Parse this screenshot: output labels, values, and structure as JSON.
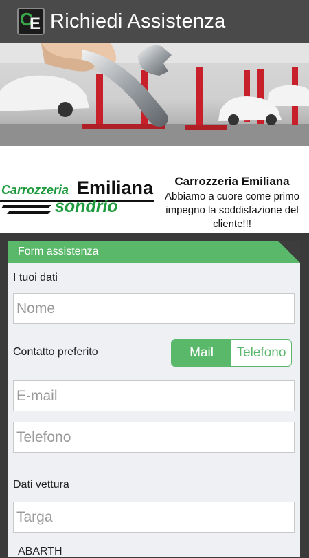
{
  "actionbar": {
    "title": "Richiedi Assistenza",
    "logo_letters": [
      "C",
      "E"
    ]
  },
  "hero": {
    "image": "car-repair-wrench-photo"
  },
  "brand": {
    "logo_line1": "Carrozzeria",
    "logo_line1b": "Emiliana",
    "logo_line2": "sondrio",
    "name": "Carrozzeria Emiliana",
    "slogan": "Abbiamo a cuore come primo impegno la soddisfazione del cliente!!!"
  },
  "form": {
    "header": "Form assistenza",
    "section_personal": "I tuoi dati",
    "name_placeholder": "Nome",
    "contact_label": "Contatto preferito",
    "contact_options": [
      "Mail",
      "Telefono"
    ],
    "contact_selected": "Mail",
    "email_placeholder": "E-mail",
    "phone_placeholder": "Telefono",
    "section_vehicle": "Dati vettura",
    "plate_placeholder": "Targa",
    "next_peek": "ABARTH"
  },
  "colors": {
    "accent": "#5ab86a",
    "actionbar": "#4a4a4a",
    "panel": "#eef0f3"
  }
}
